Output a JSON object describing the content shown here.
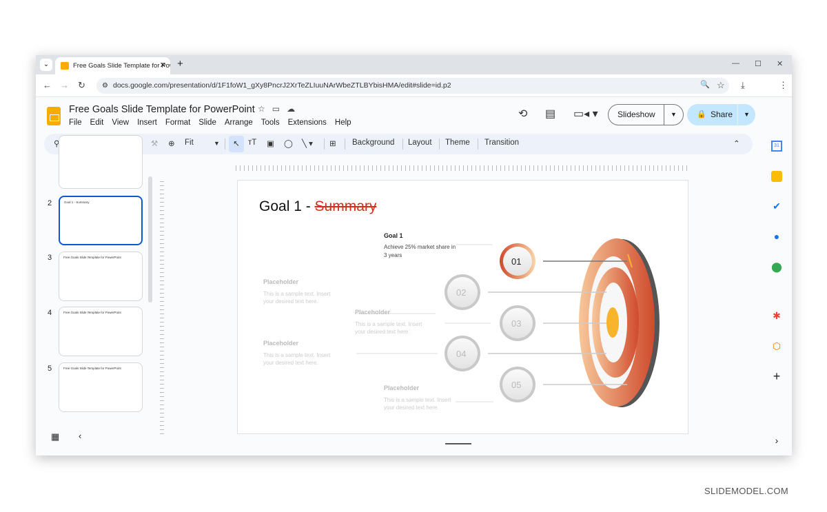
{
  "browser": {
    "tab_title": "Free Goals Slide Template for PowerPoint",
    "url": "docs.google.com/presentation/d/1F1foW1_gXy8PncrJ2XrTeZLIuuNArWbeZTLBYbisHMA/edit#slide=id.p2"
  },
  "app": {
    "doc_title": "Free Goals Slide Template for PowerPoint",
    "menu": [
      "File",
      "Edit",
      "View",
      "Insert",
      "Format",
      "Slide",
      "Arrange",
      "Tools",
      "Extensions",
      "Help"
    ],
    "slideshow_label": "Slideshow",
    "share_label": "Share"
  },
  "toolbar": {
    "zoom": "Fit",
    "background": "Background",
    "layout": "Layout",
    "theme": "Theme",
    "transition": "Transition"
  },
  "filmstrip": {
    "slides": [
      {
        "number": "2",
        "title": "Goal 1 - Summary"
      },
      {
        "number": "3",
        "title": "Free Goals Slide Template for PowerPoint"
      },
      {
        "number": "4",
        "title": "Free Goals Slide Template for PowerPoint"
      },
      {
        "number": "5",
        "title": "Free Goals Slide Template for PowerPoint"
      }
    ],
    "selected": "2"
  },
  "slide": {
    "title_main": "Goal 1 - ",
    "title_struck": "Summary",
    "goal": {
      "heading": "Goal 1",
      "text": "Achieve 25% market share in",
      "text2": "3 years"
    },
    "placeholder": {
      "heading": "Placeholder",
      "line1": "This is a sample text. Insert",
      "line2": "your desired text here."
    },
    "circles": [
      "01",
      "02",
      "03",
      "04",
      "05"
    ],
    "colors": {
      "accent": "#d24a2e",
      "light": "#f7b98a",
      "bullseye": "#f9b42d"
    }
  },
  "footer": "SLIDEMODEL.COM"
}
